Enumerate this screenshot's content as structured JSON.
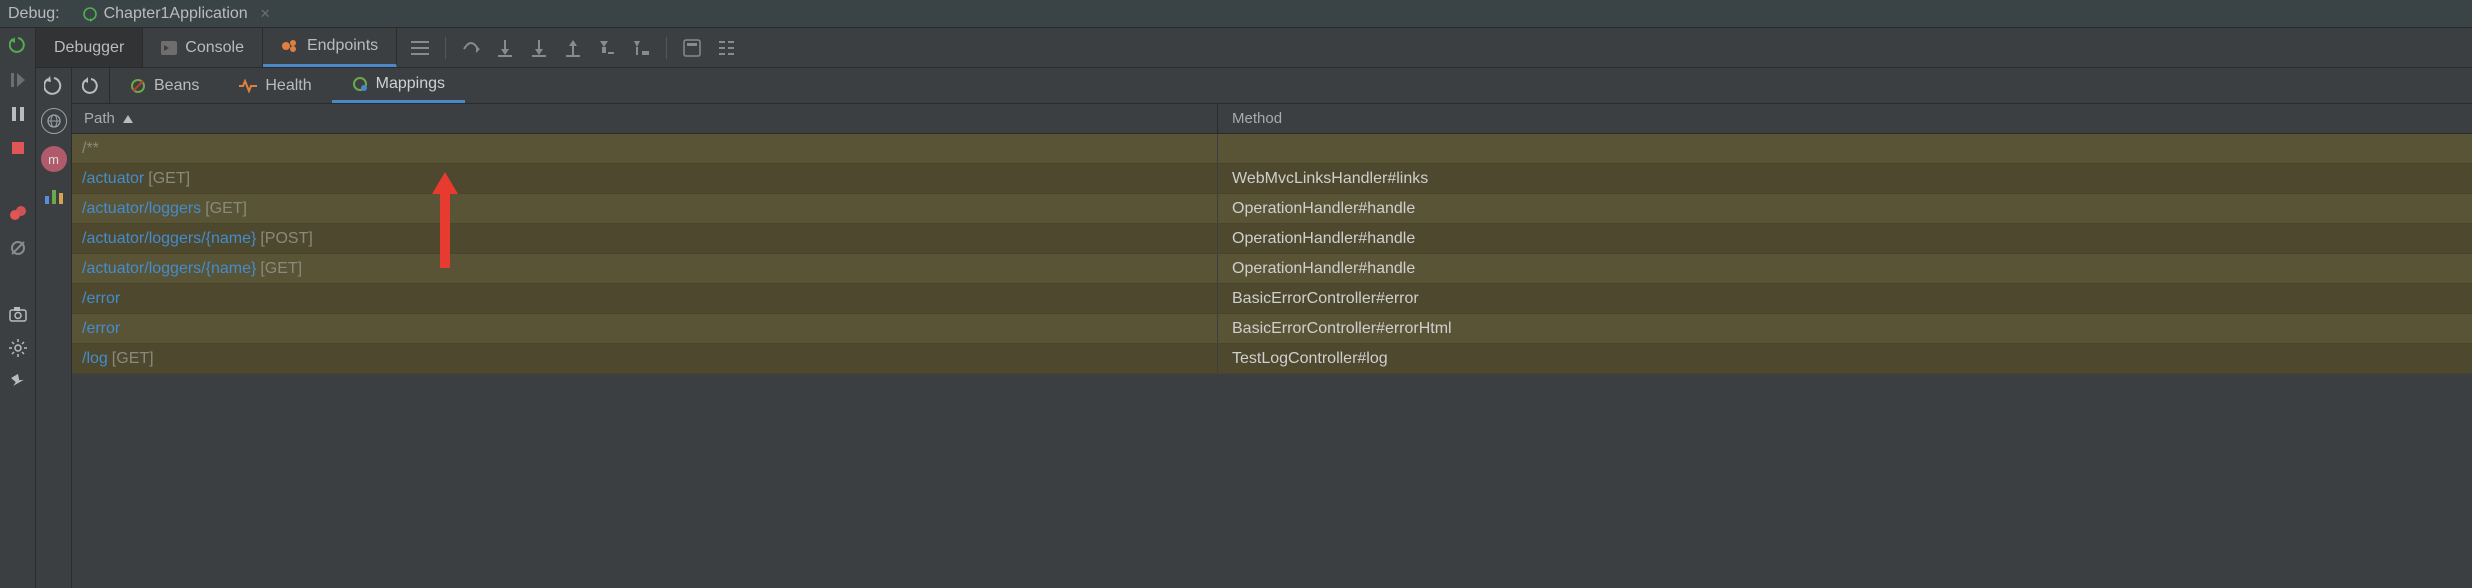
{
  "title_bar": {
    "label": "Debug:",
    "run_config": "Chapter1Application"
  },
  "tool_tabs": {
    "debugger": "Debugger",
    "console": "Console",
    "endpoints": "Endpoints"
  },
  "sub_tabs": {
    "beans": "Beans",
    "health": "Health",
    "mappings": "Mappings"
  },
  "table": {
    "header_path": "Path",
    "header_method": "Method",
    "rows": [
      {
        "path": "/**",
        "verb": "",
        "method": ""
      },
      {
        "path": "/actuator",
        "verb": "[GET]",
        "method": "WebMvcLinksHandler#links"
      },
      {
        "path": "/actuator/loggers",
        "verb": "[GET]",
        "method": "OperationHandler#handle"
      },
      {
        "path": "/actuator/loggers/{name}",
        "verb": "[POST]",
        "method": "OperationHandler#handle"
      },
      {
        "path": "/actuator/loggers/{name}",
        "verb": "[GET]",
        "method": "OperationHandler#handle"
      },
      {
        "path": "/error",
        "verb": "",
        "method": "BasicErrorController#error"
      },
      {
        "path": "/error",
        "verb": "",
        "method": "BasicErrorController#errorHtml"
      },
      {
        "path": "/log",
        "verb": "[GET]",
        "method": "TestLogController#log"
      }
    ]
  }
}
